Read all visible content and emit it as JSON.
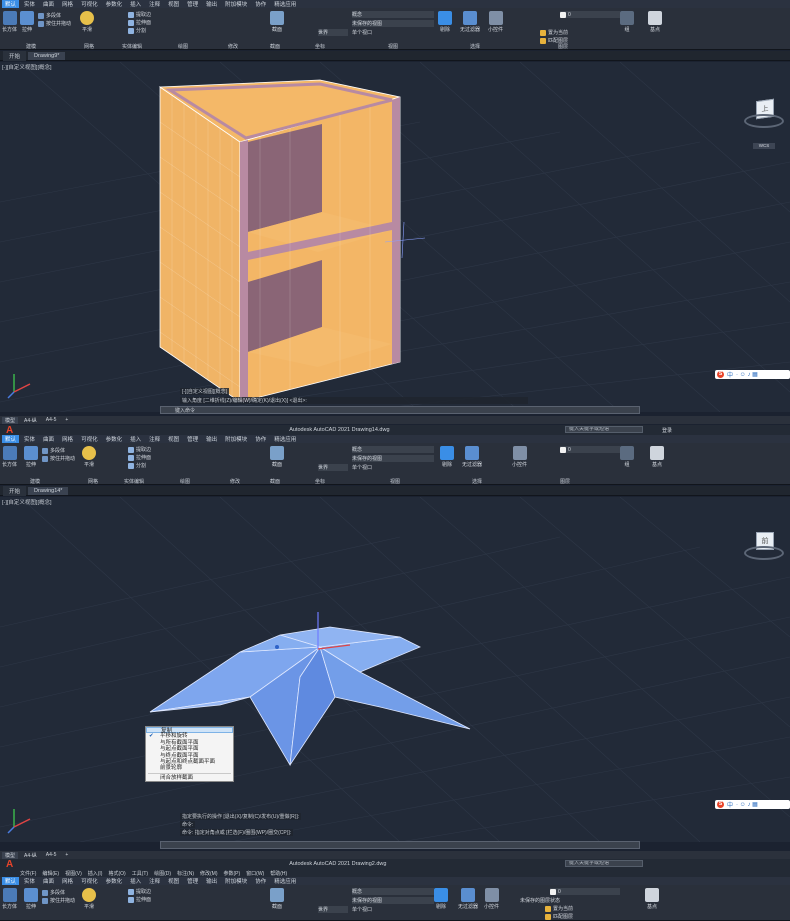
{
  "ribbon_tabs": [
    "默认",
    "实体",
    "曲面",
    "网格",
    "可视化",
    "参数化",
    "插入",
    "注释",
    "视图",
    "管理",
    "输出",
    "附加模块",
    "协作",
    "精选应用"
  ],
  "ribbon": {
    "modeling": [
      "长方体",
      "拉伸"
    ],
    "smooth": [
      "平滑",
      "对象"
    ],
    "mesh_small": [
      "多段体",
      "按住并拖动"
    ],
    "mesh_edit": [
      "提取边",
      "拉伸面",
      "分割"
    ],
    "groups": [
      "建模",
      "网格",
      "实体编辑",
      "绘图",
      "修改",
      "截面",
      "坐标",
      "视图",
      "选择",
      "图层"
    ],
    "section_btn": [
      "截面",
      "平面"
    ],
    "gizmo": [
      "小控件"
    ],
    "culling": [
      "剔除"
    ],
    "filter": [
      "无过滤器"
    ],
    "layer_dropdown": "0",
    "visual_dropdown": "概念",
    "view_dropdown": "未保存的视图",
    "world_dropdown": "世界",
    "viewport_dropdown": "单个视口",
    "layer_state": "未保存的图层状态",
    "layer_tools": [
      "置为当前",
      "匹配图层"
    ],
    "base": [
      "基点"
    ],
    "group": [
      "组"
    ]
  },
  "panel1": {
    "file_tabs": [
      "开始",
      "Drawing9*"
    ],
    "view_label": "[-][自定义视图][概念]",
    "command_line": "输入角度 [二维折线(Z)/编辑(W)/确定(K)/退出(X)] <退出>:",
    "command_placeholder": "键入命令"
  },
  "status1": {
    "tabs": [
      "模型",
      "A4-纵",
      "A4-5"
    ]
  },
  "panel2": {
    "title": "Autodesk AutoCAD 2021  Drawing14.dwg",
    "search_placeholder": "键入关键字或短语",
    "login": "登录",
    "file_tabs": [
      "开始",
      "Drawing14*"
    ],
    "view_label": "[-][自定义视图][概念]",
    "context_menu": [
      "复制",
      "平移和旋转",
      "与所有截面平面",
      "与起点截面平面",
      "与终点截面平面",
      "与起点和终点截面平面",
      "前景轮廓",
      "闭合放样截面"
    ],
    "context_menu_checked": 1,
    "command_history": [
      "指定要执行的操作 [退出(X)/复制(C)/发布(U)/重做(R)]:",
      "命令:",
      "命令: 指定对角点或 [栏选(F)/圈围(WP)/圈交(CP)]:"
    ]
  },
  "status2": {
    "tabs": [
      "模型",
      "A4-纵",
      "A4-5"
    ]
  },
  "panel3": {
    "title": "Autodesk AutoCAD 2021  Drawing2.dwg",
    "search_placeholder": "键入关键字或短语",
    "menu": [
      "文件(F)",
      "编辑(E)",
      "视图(V)",
      "插入(I)",
      "格式(O)",
      "工具(T)",
      "绘图(D)",
      "标注(N)",
      "修改(M)",
      "参数(P)",
      "窗口(W)",
      "帮助(H)"
    ]
  },
  "viewcube": {
    "face1": "上",
    "face2": "前",
    "wcs": "WCS"
  },
  "ime": {
    "label": "中"
  },
  "colors": {
    "bg": "#222a38",
    "cabinet": "#f3b568",
    "frame": "#b48aa0",
    "shell": "#6d9de8",
    "accent": "#3a8ee6"
  }
}
